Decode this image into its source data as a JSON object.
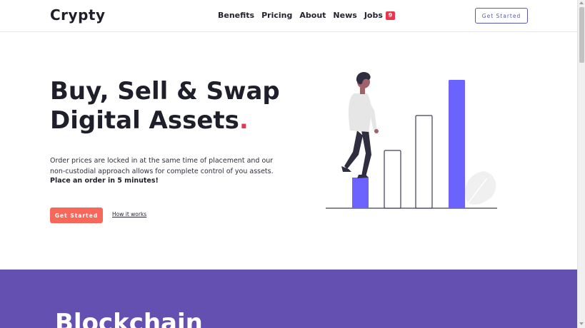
{
  "header": {
    "logo": "Crypty",
    "nav": [
      {
        "label": "Benefits"
      },
      {
        "label": "Pricing"
      },
      {
        "label": "About"
      },
      {
        "label": "News"
      },
      {
        "label": "Jobs",
        "badge": "9"
      }
    ],
    "cta_label": "Get Started"
  },
  "hero": {
    "title_line1": "Buy, Sell & Swap",
    "title_line2": "Digital Assets",
    "title_dot": ".",
    "description": "Order prices are locked in at the same time of placement and our non-custodial approach allows for complete control of you assets.",
    "strong_text": "Place an order in 5 minutes!",
    "primary_cta": "Get Started",
    "secondary_link": "How it works"
  },
  "section2": {
    "title": "Blockchain"
  },
  "colors": {
    "accent": "#6c63ff",
    "brand_purple": "#6350b0",
    "cta": "#f7685a",
    "dot_red": "#e8364f"
  }
}
